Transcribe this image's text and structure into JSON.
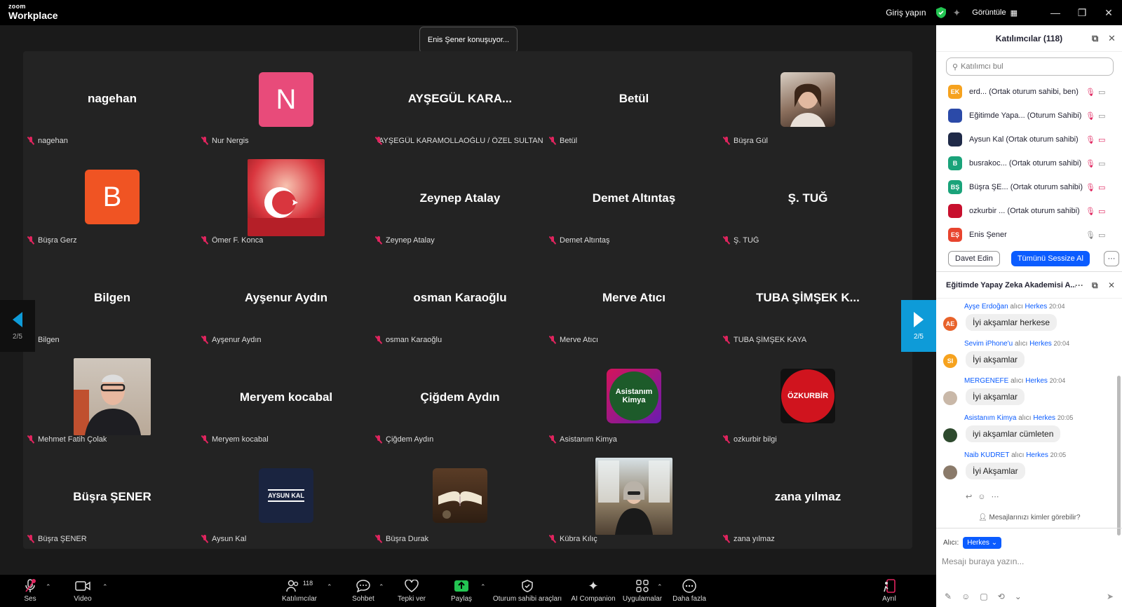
{
  "titlebar": {
    "brand_top": "zoom",
    "brand_bottom": "Workplace",
    "signin": "Giriş yapın",
    "view_label": "Görüntüle",
    "minimize": "—",
    "restore": "❐",
    "close": "✕"
  },
  "stage": {
    "speaking": "Enis Şener konuşuyor...",
    "page_indicator": "2/5"
  },
  "tiles": [
    {
      "big": "nagehan",
      "label": "nagehan"
    },
    {
      "big": "N",
      "label": "Nur Nergis",
      "avatar_color": "#e84b7a"
    },
    {
      "big": "AYŞEGÜL  KARA...",
      "label": "AYŞEGÜL KARAMOLLAOĞLU / ÖZEL SULTAN F..."
    },
    {
      "big": "Betül",
      "label": "Betül"
    },
    {
      "big": "",
      "label": "Büşra Gül"
    },
    {
      "big": "B",
      "label": "Büşra Gerz",
      "avatar_color": "#f05423"
    },
    {
      "big": "",
      "label": "Ömer F. Konca"
    },
    {
      "big": "Zeynep Atalay",
      "label": "Zeynep Atalay"
    },
    {
      "big": "Demet Altıntaş",
      "label": "Demet Altıntaş"
    },
    {
      "big": "Ş. TUĞ",
      "label": "Ş. TUĞ"
    },
    {
      "big": "Bilgen",
      "label": "Bilgen"
    },
    {
      "big": "Ayşenur Aydın",
      "label": "Ayşenur Aydın"
    },
    {
      "big": "osman Karaoğlu",
      "label": "osman Karaoğlu"
    },
    {
      "big": "Merve Atıcı",
      "label": "Merve Atıcı"
    },
    {
      "big": "TUBA ŞİMŞEK K...",
      "label": "TUBA ŞİMŞEK KAYA"
    },
    {
      "big": "",
      "label": "Mehmet Fatih Çolak"
    },
    {
      "big": "Meryem kocabal",
      "label": "Meryem kocabal"
    },
    {
      "big": "Çiğdem Aydın",
      "label": "Çiğdem Aydın"
    },
    {
      "big": "Asistanım Kimya",
      "label": "Asistanım Kimya"
    },
    {
      "big": "ÖZKURBİR",
      "label": "ozkurbir bilgi"
    },
    {
      "big": "Büşra ŞENER",
      "label": "Büşra ŞENER"
    },
    {
      "big": "AYSUN KAL",
      "label": "Aysun Kal"
    },
    {
      "big": "",
      "label": "Büşra Durak"
    },
    {
      "big": "",
      "label": "Kübra Kılıç"
    },
    {
      "big": "zana yılmaz",
      "label": "zana yılmaz"
    }
  ],
  "toolbar": {
    "audio": "Ses",
    "video": "Video",
    "participants": "Katılımcılar",
    "participants_count": "118",
    "chat": "Sohbet",
    "react": "Tepki ver",
    "share": "Paylaş",
    "host_tools": "Oturum sahibi araçları",
    "ai": "AI Companion",
    "apps": "Uygulamalar",
    "more": "Daha fazla",
    "leave": "Ayrıl"
  },
  "participants_panel": {
    "title": "Katılımcılar (118)",
    "search_placeholder": "Katılımcı bul",
    "items": [
      {
        "initials": "EK",
        "color": "#f6a21e",
        "name": "erd...  (Ortak oturum sahibi, ben)"
      },
      {
        "initials": "",
        "color": "#2b4aa8",
        "name": "Eğitimde Yapa...  (Oturum Sahibi)"
      },
      {
        "initials": "",
        "color": "#1f2a48",
        "name": "Aysun Kal (Ortak oturum sahibi)"
      },
      {
        "initials": "B",
        "color": "#1aa37a",
        "name": "busrakoc...  (Ortak oturum sahibi)"
      },
      {
        "initials": "BŞ",
        "color": "#1aa37a",
        "name": "Büşra ŞE...  (Ortak oturum sahibi)"
      },
      {
        "initials": "",
        "color": "#c8102e",
        "name": "ozkurbir ...  (Ortak oturum sahibi)"
      },
      {
        "initials": "EŞ",
        "color": "#e8442e",
        "name": "Enis Şener"
      }
    ],
    "invite": "Davet Edin",
    "mute_all": "Tümünü Sessize Al",
    "more": "···"
  },
  "chat_panel": {
    "title": "Eğitimde Yapay Zeka Akademisi A...",
    "to_word": "alıcı",
    "messages": [
      {
        "sender": "Ayşe Erdoğan",
        "to": "Herkes",
        "time": "20:04",
        "text": "İyi akşamlar herkese",
        "initials": "AE",
        "color": "#e8622a"
      },
      {
        "sender": "Sevim iPhone'u",
        "to": "Herkes",
        "time": "20:04",
        "text": "İyi akşamlar",
        "initials": "SI",
        "color": "#f6a21e"
      },
      {
        "sender": "MERGENEFE",
        "to": "Herkes",
        "time": "20:04",
        "text": "İyi akşamlar",
        "initials": "",
        "color": "#c9b8a8"
      },
      {
        "sender": "Asistanım Kimya",
        "to": "Herkes",
        "time": "20:05",
        "text": "iyi akşamlar cümleten",
        "initials": "",
        "color": "#2e4a2e"
      },
      {
        "sender": "Naib KUDRET",
        "to": "Herkes",
        "time": "20:05",
        "text": "İyi Akşamlar",
        "initials": "",
        "color": "#8a7a6a"
      }
    ],
    "who_can_see": "Mesajlarınızı kimler görebilir?",
    "recipient_label": "Alıcı:",
    "recipient_value": "Herkes ⌄",
    "input_placeholder": "Mesajı buraya yazın..."
  }
}
